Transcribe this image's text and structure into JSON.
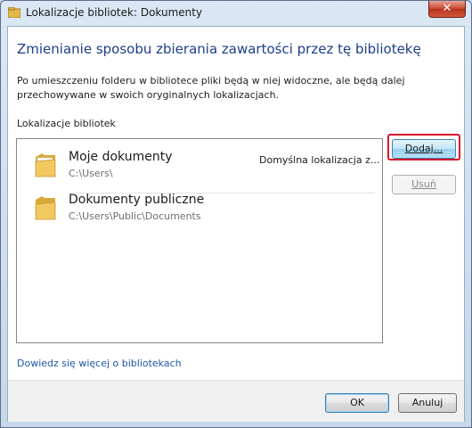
{
  "window": {
    "title": "Lokalizacje bibliotek: Dokumenty",
    "close_label": "✕"
  },
  "header": {
    "heading": "Zmienianie sposobu zbierania zawartości przez tę bibliotekę",
    "description": "Po umieszczeniu folderu w bibliotece pliki będą w niej widoczne, ale będą dalej przechowywane w swoich oryginalnych lokalizacjach."
  },
  "locations": {
    "label": "Lokalizacje bibliotek",
    "items": [
      {
        "name": "Moje dokumenty",
        "path": "C:\\Users\\",
        "status": "Domyślna lokalizacja z..."
      },
      {
        "name": "Dokumenty publiczne",
        "path": "C:\\Users\\Public\\Documents",
        "status": ""
      }
    ]
  },
  "buttons": {
    "add": "Dodaj...",
    "remove": "Usuń",
    "ok": "OK",
    "cancel": "Anuluj"
  },
  "link": "Dowiedz się więcej o bibliotekach",
  "colors": {
    "heading": "#1d3e8a",
    "link": "#1e57a8",
    "highlight": "#d9142b"
  },
  "icons": {
    "folder": "folder-icon",
    "title": "library-icon",
    "close": "close-icon"
  }
}
